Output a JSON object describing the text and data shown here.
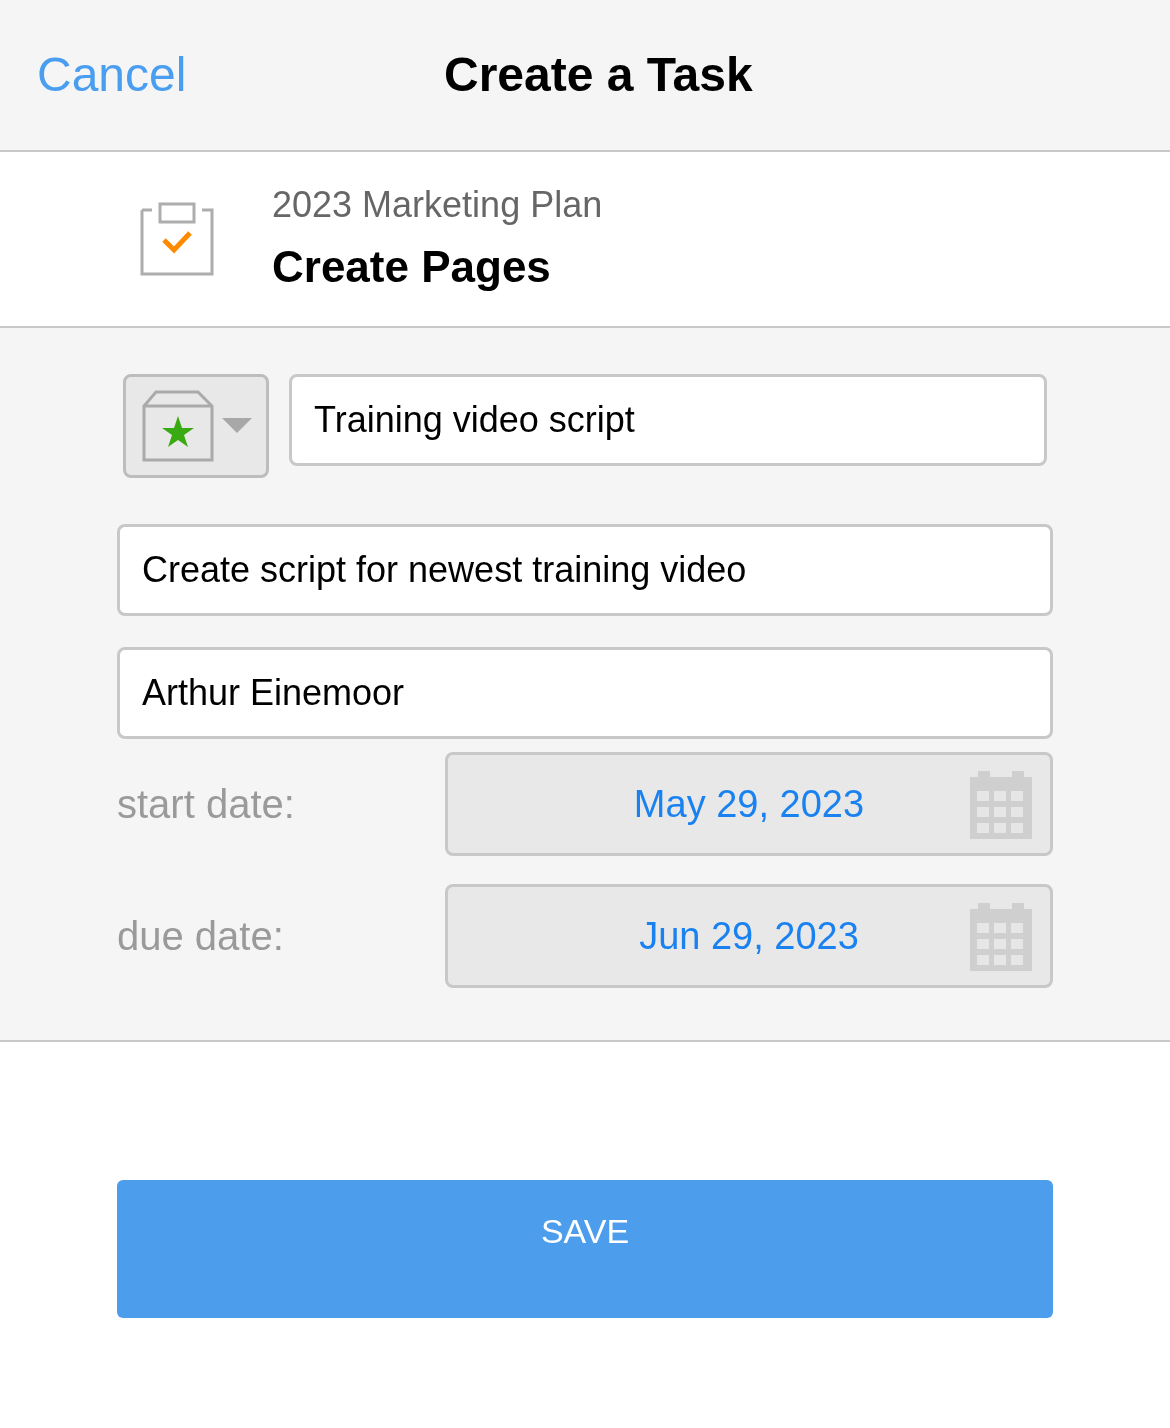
{
  "header": {
    "cancel": "Cancel",
    "title": "Create a Task"
  },
  "task": {
    "project": "2023 Marketing Plan",
    "name": "Create Pages"
  },
  "form": {
    "title_value": "Training video script",
    "description_value": "Create script for newest training video",
    "assignee_value": "Arthur Einemoor",
    "dates": [
      {
        "label": "start date:",
        "value": "May 29, 2023"
      },
      {
        "label": "due date:",
        "value": "Jun 29, 2023"
      }
    ]
  },
  "save": "SAVE"
}
